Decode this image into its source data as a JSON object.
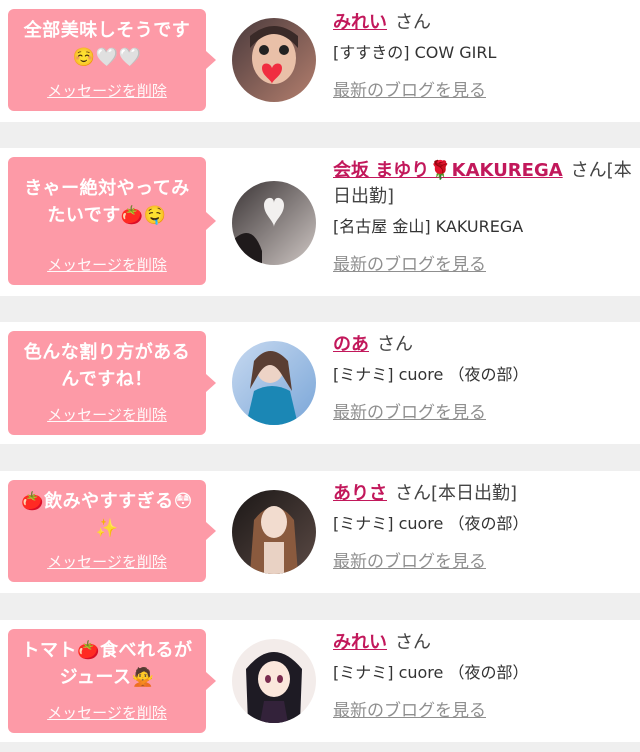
{
  "colors": {
    "bubble": "#fd9aa7",
    "name": "#c2185b",
    "link_gray": "#8f8f8f",
    "background": "#efefef"
  },
  "messages": [
    {
      "text": "全部美味しそうです☺️🤍🤍",
      "delete_label": "メッセージを削除",
      "name": "みれい",
      "suffix": "さん",
      "shop": "[すすきの] COW GIRL",
      "blog_label": "最新のブログを見る"
    },
    {
      "text": "きゃー絶対やってみたいです🍅🤤",
      "delete_label": "メッセージを削除",
      "name": "会坂 まゆり🌹KAKUREGA",
      "suffix": "さん[本日出勤]",
      "shop": "[名古屋 金山] KAKUREGA",
      "blog_label": "最新のブログを見る"
    },
    {
      "text": "色んな割り方があるんですね！",
      "delete_label": "メッセージを削除",
      "name": "のあ",
      "suffix": "さん",
      "shop": "[ミナミ] cuore （夜の部）",
      "blog_label": "最新のブログを見る"
    },
    {
      "text": "🍅飲みやすすぎる😳✨",
      "delete_label": "メッセージを削除",
      "name": "ありさ",
      "suffix": "さん[本日出勤]",
      "shop": "[ミナミ] cuore （夜の部）",
      "blog_label": "最新のブログを見る"
    },
    {
      "text": "トマト🍅食べれるがジュース🙅",
      "delete_label": "メッセージを削除",
      "name": "みれい",
      "suffix": "さん",
      "shop": "[ミナミ] cuore （夜の部）",
      "blog_label": "最新のブログを見る"
    }
  ]
}
